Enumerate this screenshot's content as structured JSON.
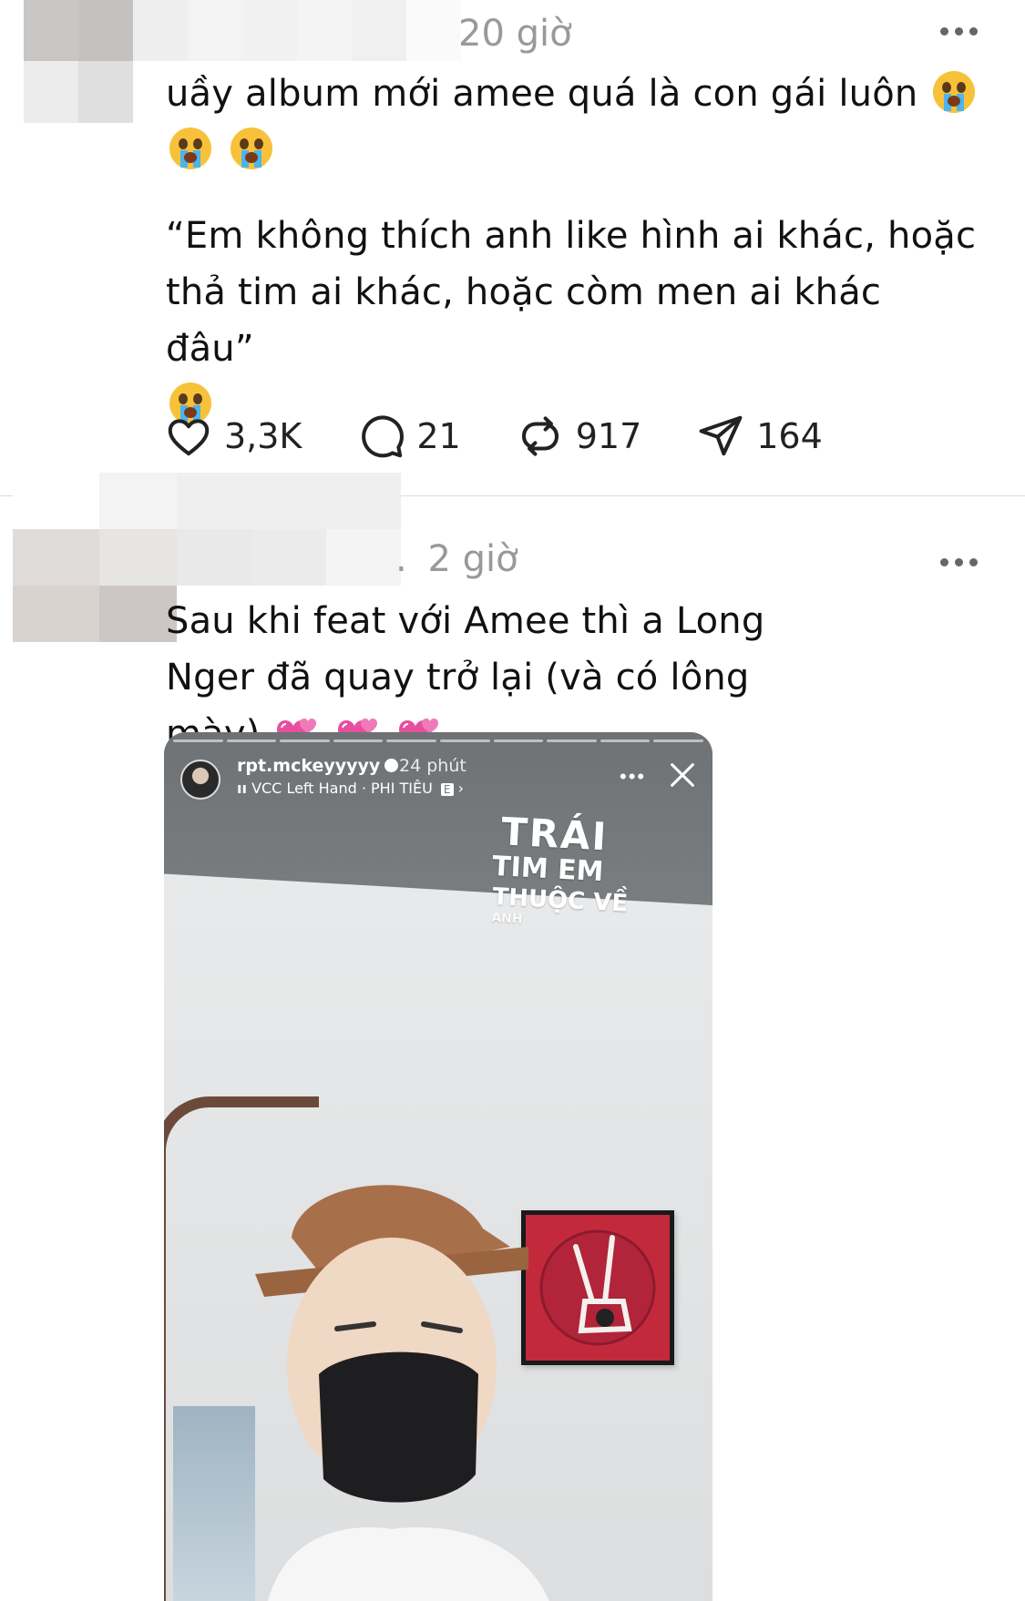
{
  "post1": {
    "time": "20 giờ",
    "text_line1": "uầy album mới amee quá là con gái luôn",
    "quote": "“Em không thích anh like hình ai khác, hoặc thả tim ai khác, hoặc còm men ai khác đâu”",
    "emojis": [
      "crying-face-emoji",
      "crying-face-emoji",
      "crying-face-emoji",
      "crying-face-emoji"
    ],
    "actions": {
      "likes": "3,3K",
      "replies": "21",
      "reposts": "917",
      "shares": "164"
    }
  },
  "post2": {
    "time_prefix": ".",
    "time": "2 giờ",
    "text": "Sau khi feat với Amee thì a Long Nger đã quay trở lại (và có lông mày)",
    "emojis": [
      "two-hearts-emoji",
      "two-hearts-emoji",
      "two-hearts-emoji"
    ],
    "story": {
      "username": "rpt.mckeyyyyy",
      "time": "24 phút",
      "song": "VCC Left Hand · PHI TIÊU",
      "explicit": "E",
      "sticker": {
        "line1": "TRÁI",
        "line2": "TIM EM",
        "line3": "THUỘC VỀ",
        "line4": "ANH"
      }
    }
  },
  "colors": {
    "meta_gray": "#999999",
    "text": "#111111",
    "divider": "#dcdcdc",
    "heart_pink": "#e6509f"
  }
}
